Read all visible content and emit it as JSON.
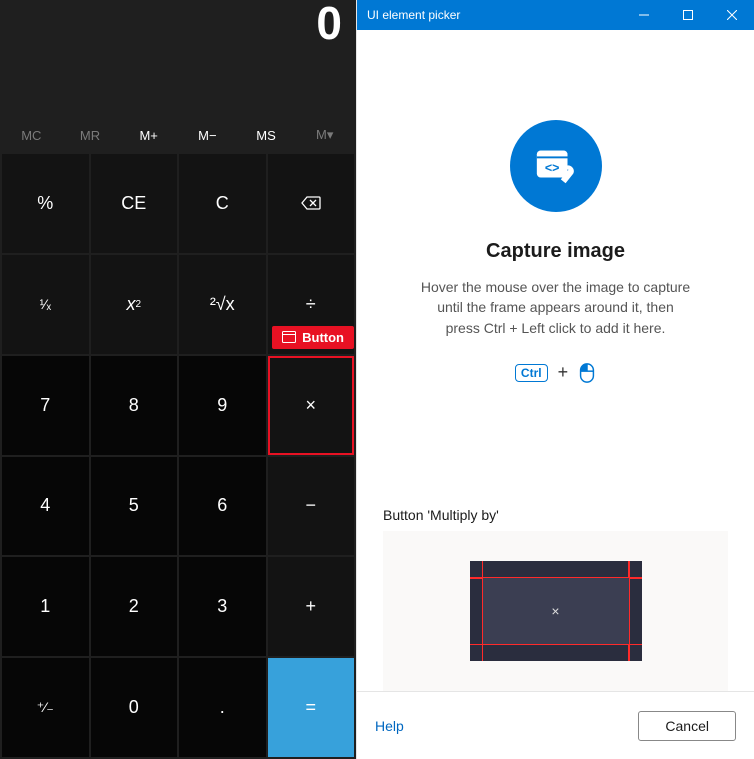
{
  "calc": {
    "display": "0",
    "memory": {
      "mc": "MC",
      "mr": "MR",
      "mplus": "M+",
      "mminus": "M−",
      "ms": "MS",
      "mlist": "M▾"
    },
    "buttons": {
      "percent": "%",
      "ce": "CE",
      "c": "C",
      "reciprocal": "¹⁄ₓ",
      "square": "x²",
      "sqrt": "²√x",
      "divide": "÷",
      "n7": "7",
      "n8": "8",
      "n9": "9",
      "multiply": "×",
      "n4": "4",
      "n5": "5",
      "n6": "6",
      "minus": "−",
      "n1": "1",
      "n2": "2",
      "n3": "3",
      "plus": "+",
      "negate": "⁺⁄₋",
      "n0": "0",
      "decimal": ".",
      "equals": "="
    }
  },
  "highlight_badge": "Button",
  "picker": {
    "title": "UI element picker",
    "heading": "Capture image",
    "instructions_l1": "Hover the mouse over the image to capture",
    "instructions_l2": "until the frame appears around it, then",
    "instructions_l3": "press Ctrl + Left click to add it here.",
    "ctrl_key": "Ctrl",
    "captured_label": "Button 'Multiply by'",
    "thumbnail_symbol": "×",
    "help": "Help",
    "cancel": "Cancel"
  }
}
